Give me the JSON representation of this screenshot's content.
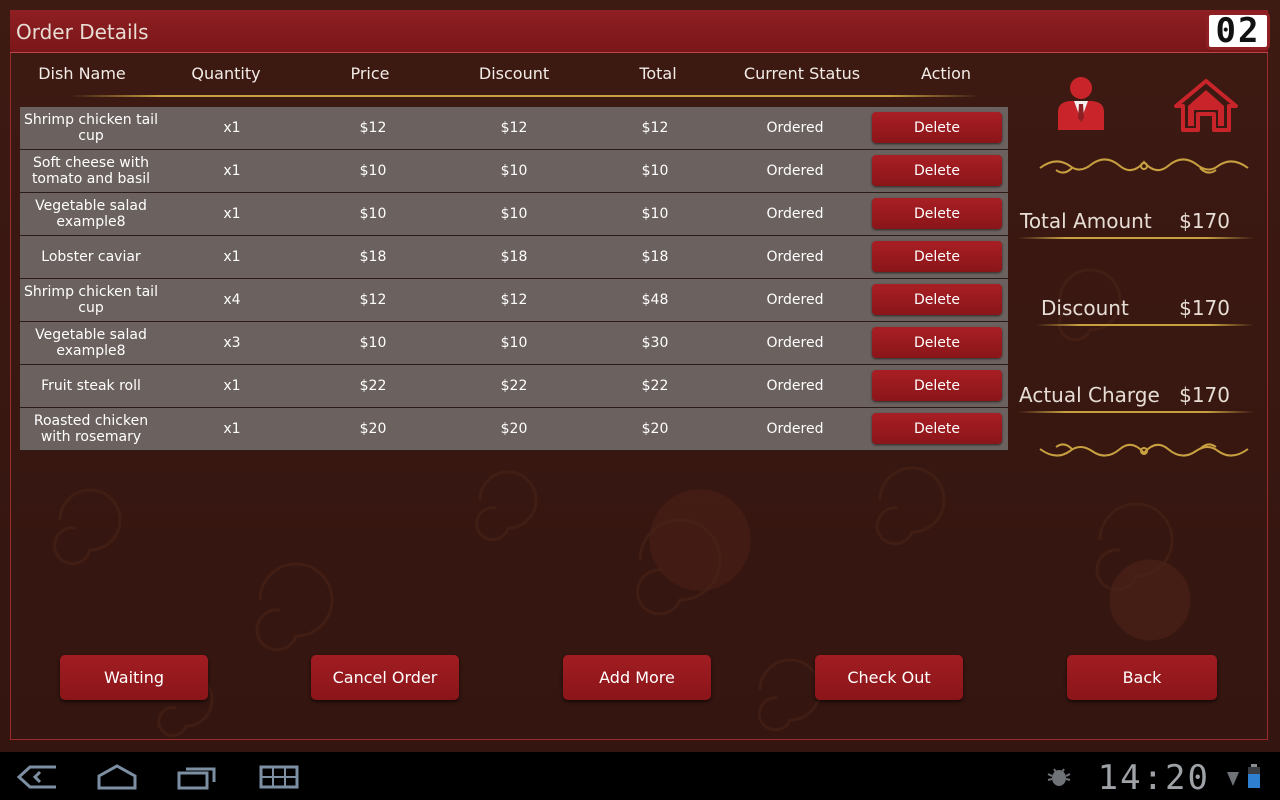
{
  "header": {
    "title": "Order Details",
    "table_number": "02"
  },
  "table": {
    "columns": [
      "Dish Name",
      "Quantity",
      "Price",
      "Discount",
      "Total",
      "Current Status",
      "Action"
    ],
    "rows": [
      {
        "name": "Shrimp chicken tail cup",
        "qty": "x1",
        "price": "$12",
        "discount": "$12",
        "total": "$12",
        "status": "Ordered",
        "action": "Delete"
      },
      {
        "name": "Soft cheese with tomato and basil",
        "qty": "x1",
        "price": "$10",
        "discount": "$10",
        "total": "$10",
        "status": "Ordered",
        "action": "Delete"
      },
      {
        "name": "Vegetable salad example8",
        "qty": "x1",
        "price": "$10",
        "discount": "$10",
        "total": "$10",
        "status": "Ordered",
        "action": "Delete"
      },
      {
        "name": "Lobster caviar",
        "qty": "x1",
        "price": "$18",
        "discount": "$18",
        "total": "$18",
        "status": "Ordered",
        "action": "Delete"
      },
      {
        "name": "Shrimp chicken tail cup",
        "qty": "x4",
        "price": "$12",
        "discount": "$12",
        "total": "$48",
        "status": "Ordered",
        "action": "Delete"
      },
      {
        "name": "Vegetable salad example8",
        "qty": "x3",
        "price": "$10",
        "discount": "$10",
        "total": "$30",
        "status": "Ordered",
        "action": "Delete"
      },
      {
        "name": "Fruit steak roll",
        "qty": "x1",
        "price": "$22",
        "discount": "$22",
        "total": "$22",
        "status": "Ordered",
        "action": "Delete"
      },
      {
        "name": "Roasted chicken with rosemary",
        "qty": "x1",
        "price": "$20",
        "discount": "$20",
        "total": "$20",
        "status": "Ordered",
        "action": "Delete"
      }
    ]
  },
  "summary": {
    "total_amount_label": "Total Amount",
    "total_amount": "$170",
    "discount_label": "Discount",
    "discount": "$170",
    "actual_charge_label": "Actual Charge",
    "actual_charge": "$170"
  },
  "icons": {
    "waiter": "waiter-icon",
    "home": "home-icon"
  },
  "buttons": {
    "waiting": "Waiting",
    "cancel_order": "Cancel Order",
    "add_more": "Add More",
    "check_out": "Check Out",
    "back": "Back"
  },
  "system_bar": {
    "time": "14:20"
  },
  "colors": {
    "accent_red": "#8e1f22",
    "gold": "#c8a040",
    "row_gray": "#6b615e"
  }
}
